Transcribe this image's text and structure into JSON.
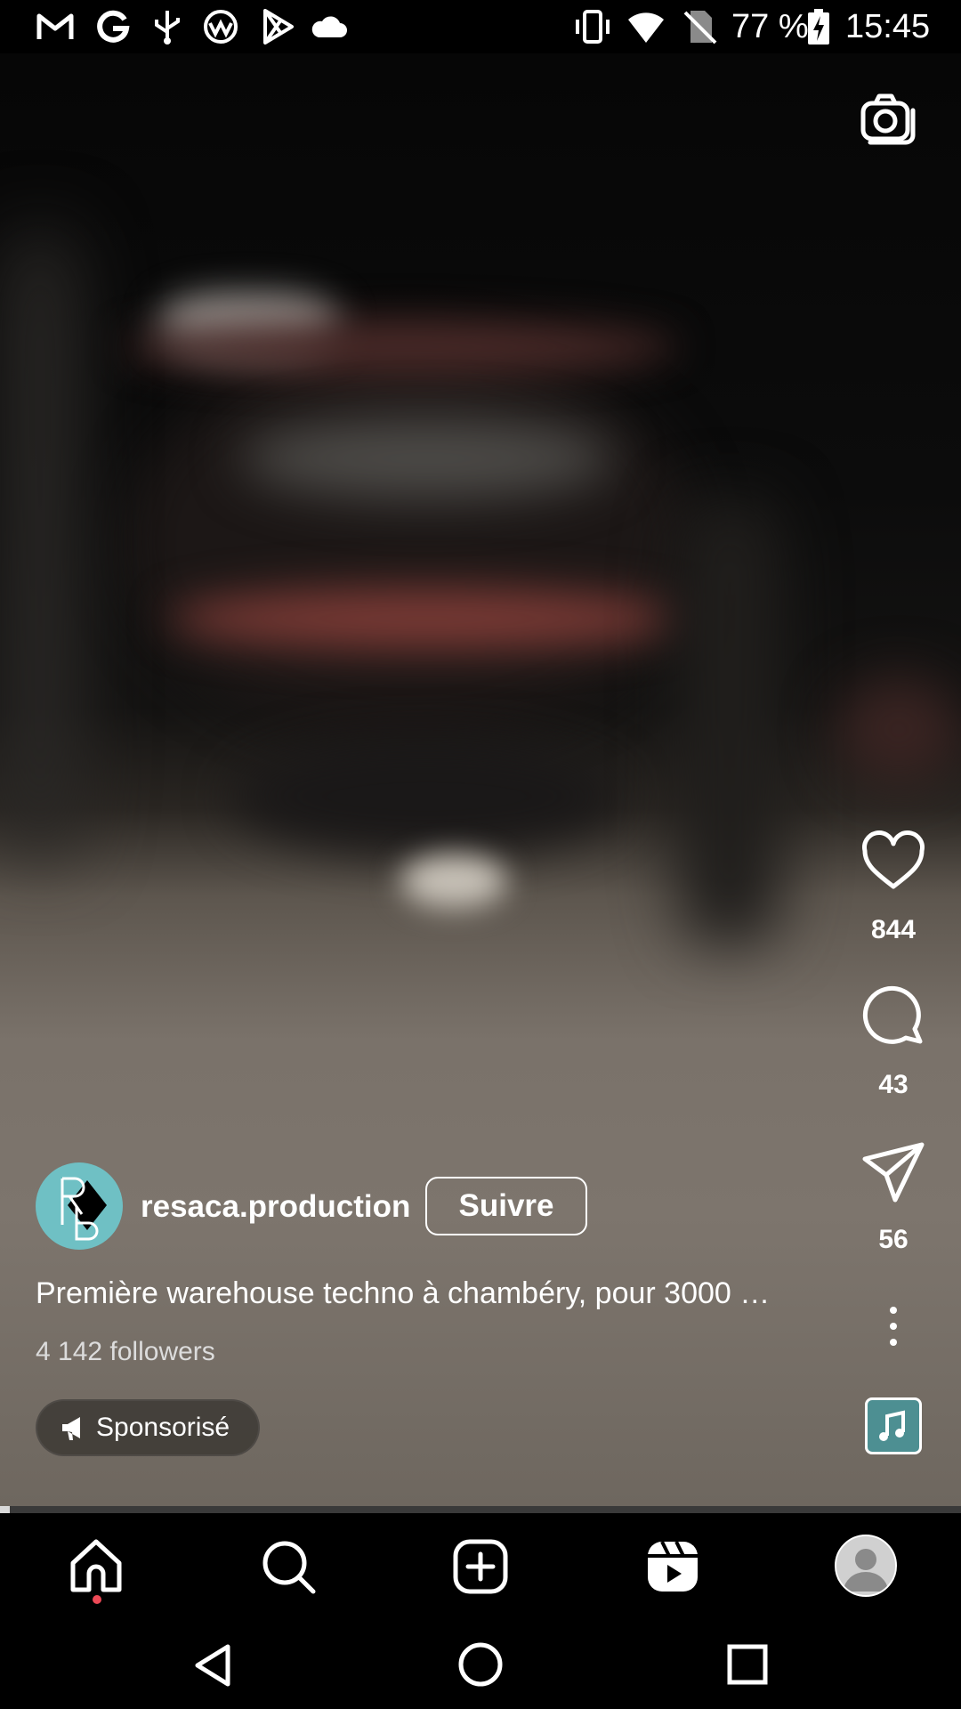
{
  "status_bar": {
    "left_icons": [
      "gmail-icon",
      "google-icon",
      "usb-icon",
      "app-icon",
      "play-store-icon",
      "cloud-icon"
    ],
    "right_icons": [
      "vibrate-icon",
      "wifi-icon",
      "no-sim-icon",
      "battery-charging-icon"
    ],
    "battery": "77 %",
    "time": "15:45"
  },
  "reel": {
    "username": "resaca.production",
    "follow_label": "Suivre",
    "caption": "Première warehouse techno à chambéry, pour 3000 …",
    "followers": "4 142 followers",
    "sponsored_label": "Sponsorisé",
    "likes": "844",
    "comments": "43",
    "shares": "56",
    "progress_fraction": 0.01,
    "avatar_monogram": "RB"
  },
  "tab_bar": {
    "items": [
      "home-icon",
      "search-icon",
      "create-icon",
      "reels-icon",
      "profile-icon"
    ],
    "home_notification_dot_color": "#ed4956"
  },
  "system_nav": {
    "items": [
      "back-icon",
      "home-circle-icon",
      "recents-icon"
    ]
  }
}
